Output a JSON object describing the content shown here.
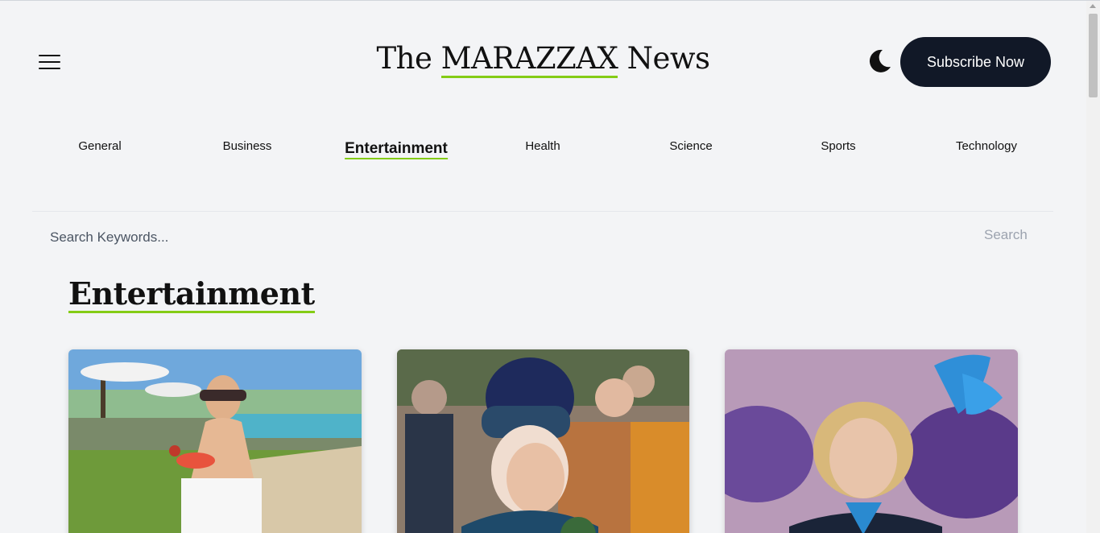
{
  "header": {
    "title_prefix": "The ",
    "title_brand": "MARAZZAX",
    "title_suffix": " News",
    "subscribe_label": "Subscribe Now",
    "menu_icon": "hamburger-icon",
    "theme_icon": "moon-icon"
  },
  "nav": {
    "items": [
      {
        "label": "General"
      },
      {
        "label": "Business"
      },
      {
        "label": "Entertainment",
        "active": true
      },
      {
        "label": "Health"
      },
      {
        "label": "Science"
      },
      {
        "label": "Sports"
      },
      {
        "label": "Technology"
      }
    ]
  },
  "search": {
    "placeholder": "Search Keywords...",
    "button_label": "Search"
  },
  "section": {
    "title": "Entertainment"
  },
  "colors": {
    "accent": "#84cc16",
    "button_bg": "#111827",
    "page_bg": "#f3f4f6"
  }
}
